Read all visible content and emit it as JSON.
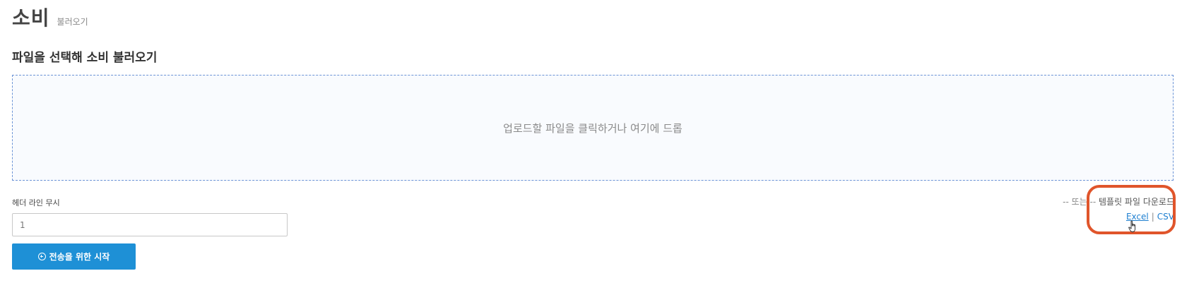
{
  "header": {
    "title": "소비",
    "subtitle": "불러오기"
  },
  "section": {
    "title": "파일을 선택해 소비 불러오기"
  },
  "dropzone": {
    "text": "업로드할 파일을 클릭하거나 여기에 드롭"
  },
  "skip_header": {
    "label": "헤더 라인 무시",
    "value": "1"
  },
  "start_button": {
    "label": "전송을 위한 시작",
    "icon": "plus-circle-icon"
  },
  "template": {
    "or_text": "-- 또는 --",
    "title": "템플릿 파일 다운로드",
    "excel_label": "Excel",
    "separator": "|",
    "csv_label": "CSV"
  },
  "colors": {
    "accent": "#1e90d6",
    "link": "#1e7fd0",
    "highlight": "#e0552b",
    "dropzone_border": "#6a93d6"
  }
}
